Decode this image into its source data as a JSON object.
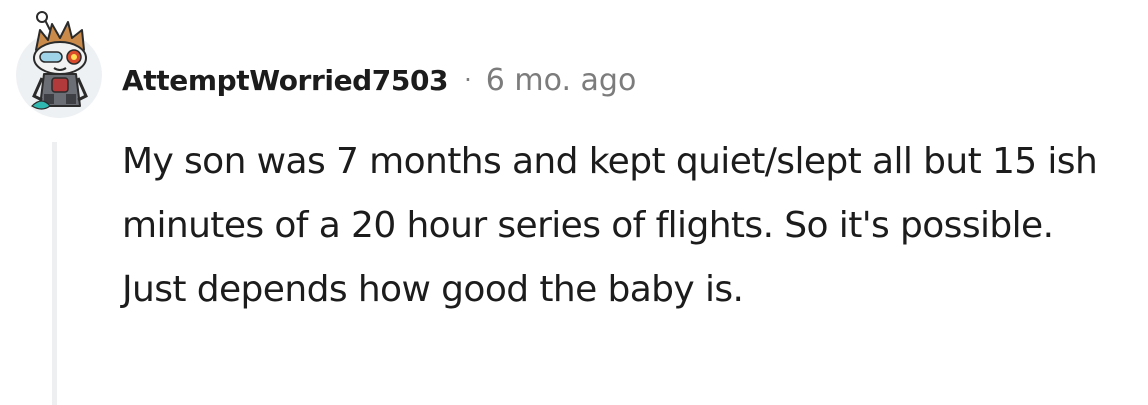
{
  "comment": {
    "username": "AttemptWorried7503",
    "separator": "·",
    "timestamp": "6 mo. ago",
    "body": "My son was 7 months and kept quiet/slept all but 15 ish minutes of a 20 hour series of flights. So it's possible. Just depends how good the baby is.",
    "avatar": "reddit-snoo-avatar-icon"
  }
}
